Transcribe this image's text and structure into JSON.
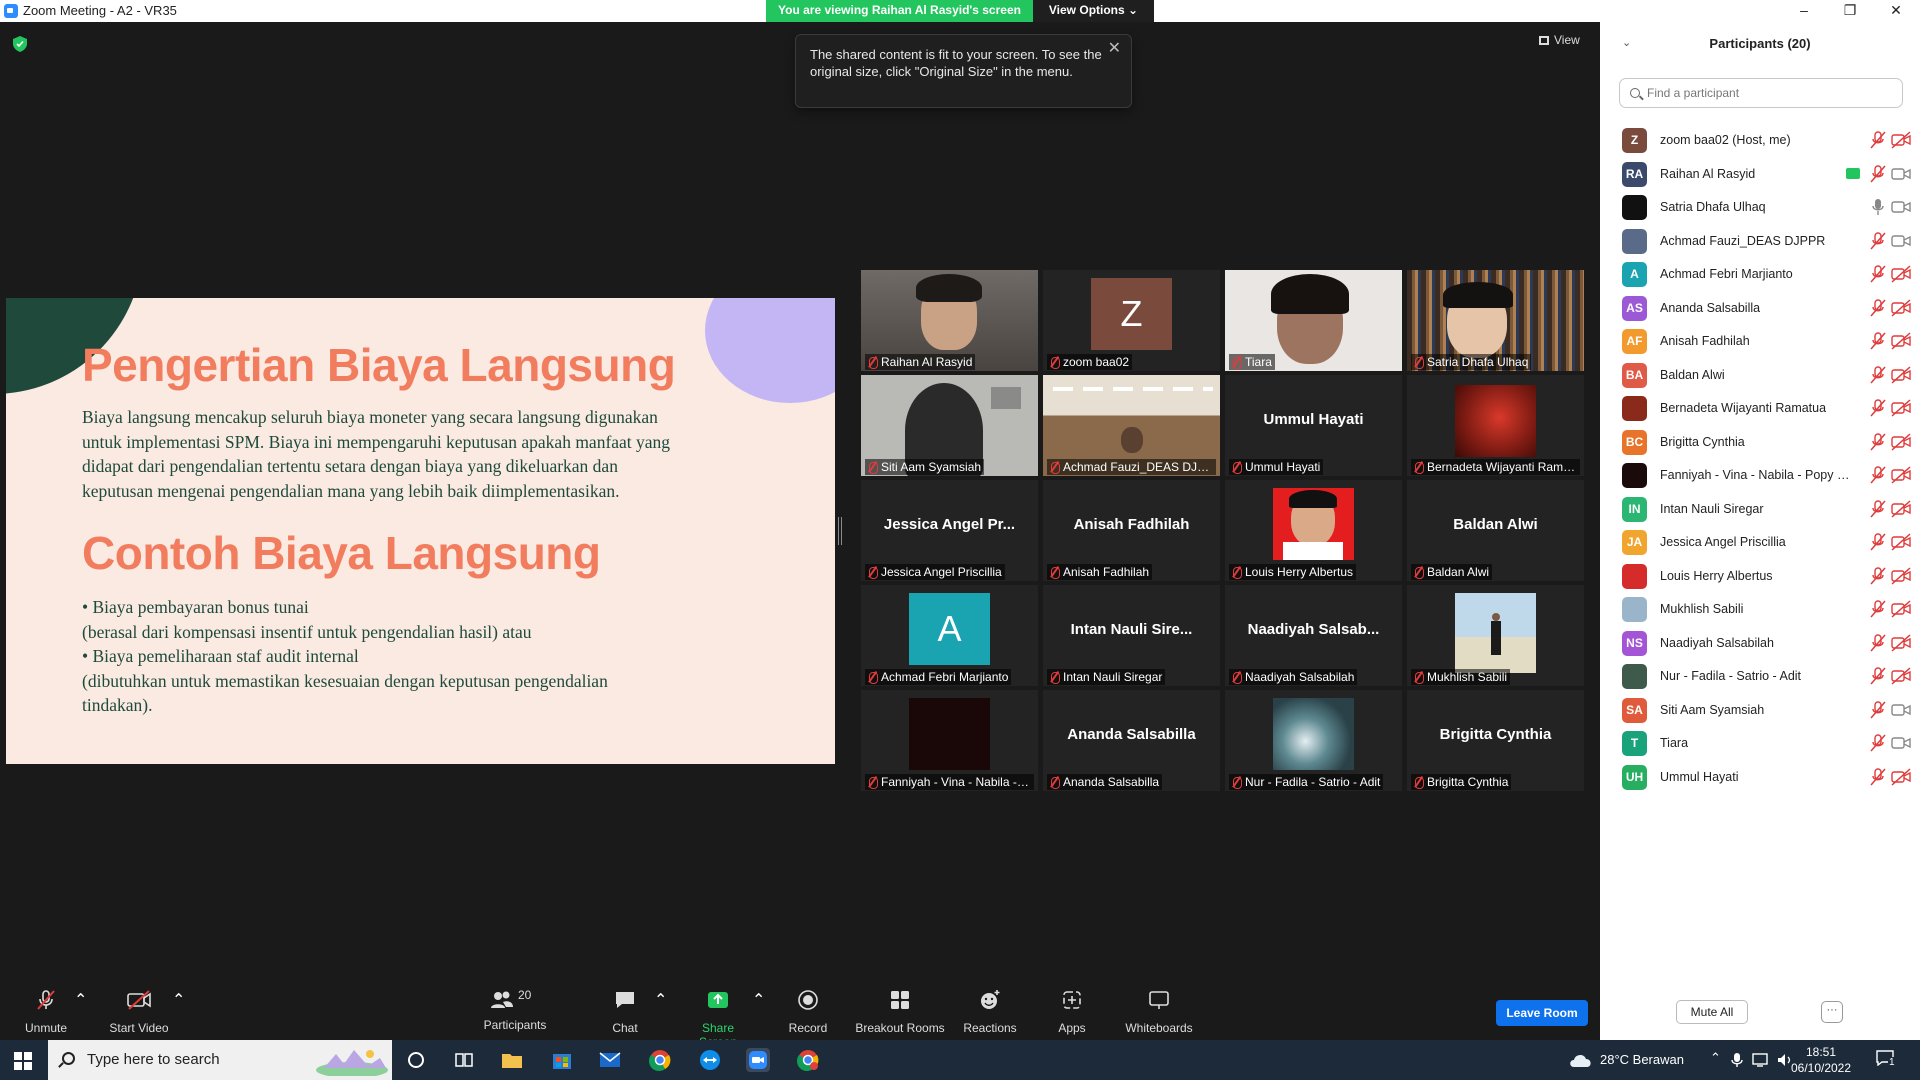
{
  "window": {
    "title": "Zoom Meeting - A2 - VR35",
    "viewing_banner": "You are viewing Raihan Al Rasyid's screen",
    "view_options": "View Options"
  },
  "tooltip": {
    "text": "The shared content is fit to your screen. To see the original size, click \"Original Size\" in the menu."
  },
  "view_button": "View",
  "slide": {
    "heading1": "Pengertian Biaya Langsung",
    "paragraph1": " Biaya langsung mencakup seluruh biaya moneter yang secara langsung digunakan untuk implementasi SPM. Biaya ini mempengaruhi keputusan apakah manfaat yang didapat dari pengendalian tertentu setara dengan biaya yang dikeluarkan dan keputusan mengenai pengendalian mana yang lebih baik diimplementasikan.",
    "heading2": "Contoh Biaya Langsung",
    "lines": [
      "• Biaya pembayaran bonus  tunai",
      "(berasal dari kompensasi insentif untuk pengendalian hasil) atau",
      "• Biaya pemeliharaan staf audit internal",
      "(dibutuhkan untuk memastikan kesesuaian dengan keputusan pengendalian",
      "tindakan)."
    ]
  },
  "tiles": [
    {
      "label": "Raihan Al Rasyid",
      "type": "video"
    },
    {
      "label": "zoom baa02",
      "type": "avatar",
      "letter": "Z"
    },
    {
      "label": "Tiara",
      "type": "video"
    },
    {
      "label": "Satria Dhafa Ulhaq",
      "type": "video",
      "active": true
    },
    {
      "label": "Siti Aam Syamsiah",
      "type": "video"
    },
    {
      "label": "Achmad Fauzi_DEAS DJPPR",
      "type": "video"
    },
    {
      "label": "Ummul Hayati",
      "type": "name",
      "bigname": "Ummul Hayati"
    },
    {
      "label": "Bernadeta Wijayanti Ramatua",
      "type": "photo"
    },
    {
      "label": "Jessica Angel Priscillia",
      "type": "name",
      "bigname": "Jessica Angel Pr..."
    },
    {
      "label": "Anisah Fadhilah",
      "type": "name",
      "bigname": "Anisah Fadhilah"
    },
    {
      "label": "Louis Herry Albertus",
      "type": "photo"
    },
    {
      "label": "Baldan Alwi",
      "type": "name",
      "bigname": "Baldan Alwi"
    },
    {
      "label": "Achmad Febri Marjianto",
      "type": "avatar",
      "letter": "A"
    },
    {
      "label": "Intan Nauli Siregar",
      "type": "name",
      "bigname": "Intan Nauli Sire..."
    },
    {
      "label": "Naadiyah Salsabilah",
      "type": "name",
      "bigname": "Naadiyah Salsab..."
    },
    {
      "label": "Mukhlish Sabili",
      "type": "photo"
    },
    {
      "label": "Fanniyah - Vina - Nabila - Popy - Adit",
      "type": "photo"
    },
    {
      "label": "Ananda Salsabilla",
      "type": "name",
      "bigname": "Ananda Salsabilla"
    },
    {
      "label": "Nur - Fadila - Satrio - Adit",
      "type": "photo"
    },
    {
      "label": "Brigitta Cynthia",
      "type": "name",
      "bigname": "Brigitta Cynthia"
    }
  ],
  "toolbar": {
    "unmute": "Unmute",
    "start_video": "Start Video",
    "participants": "Participants",
    "participants_count": "20",
    "chat": "Chat",
    "share_screen": "Share Screen",
    "record": "Record",
    "breakout_rooms": "Breakout Rooms",
    "reactions": "Reactions",
    "apps": "Apps",
    "whiteboards": "Whiteboards",
    "leave_room": "Leave Room"
  },
  "panel": {
    "title": "Participants (20)",
    "search_placeholder": "Find a participant",
    "mute_all": "Mute All",
    "more": "···",
    "participants": [
      {
        "initials": "Z",
        "name": "zoom baa02 (Host, me)",
        "color": "#7a4a3c",
        "cam": "off"
      },
      {
        "initials": "RA",
        "name": "Raihan Al Rasyid",
        "color": "#3b4a6b",
        "cam": "on",
        "sharing": true
      },
      {
        "initials": "",
        "name": "Satria Dhafa Ulhaq",
        "color": "#111111",
        "cam": "on",
        "mic": "on"
      },
      {
        "initials": "",
        "name": "Achmad Fauzi_DEAS DJPPR",
        "color": "#5a6b8a",
        "cam": "on"
      },
      {
        "initials": "A",
        "name": "Achmad Febri Marjianto",
        "color": "#1aa3b0",
        "cam": "off"
      },
      {
        "initials": "AS",
        "name": "Ananda Salsabilla",
        "color": "#9b59d6",
        "cam": "off"
      },
      {
        "initials": "AF",
        "name": "Anisah Fadhilah",
        "color": "#f29a2e",
        "cam": "off"
      },
      {
        "initials": "BA",
        "name": "Baldan Alwi",
        "color": "#e05a48",
        "cam": "off"
      },
      {
        "initials": "",
        "name": "Bernadeta Wijayanti Ramatua",
        "color": "#8a2a1a",
        "cam": "off"
      },
      {
        "initials": "BC",
        "name": "Brigitta Cynthia",
        "color": "#e8742c",
        "cam": "off"
      },
      {
        "initials": "",
        "name": "Fanniyah - Vina - Nabila - Popy - Adit",
        "color": "#1a0a0a",
        "cam": "off"
      },
      {
        "initials": "IN",
        "name": "Intan Nauli Siregar",
        "color": "#2bb673",
        "cam": "off"
      },
      {
        "initials": "JA",
        "name": "Jessica Angel Priscillia",
        "color": "#f0a52e",
        "cam": "off"
      },
      {
        "initials": "",
        "name": "Louis Herry Albertus",
        "color": "#d62b2b",
        "cam": "off"
      },
      {
        "initials": "",
        "name": "Mukhlish Sabili",
        "color": "#9ab5c9",
        "cam": "off"
      },
      {
        "initials": "NS",
        "name": "Naadiyah Salsabilah",
        "color": "#a455d6",
        "cam": "off"
      },
      {
        "initials": "",
        "name": "Nur - Fadila - Satrio - Adit",
        "color": "#3d5a4a",
        "cam": "off"
      },
      {
        "initials": "SA",
        "name": "Siti Aam Syamsiah",
        "color": "#e05a3c",
        "cam": "on"
      },
      {
        "initials": "T",
        "name": "Tiara",
        "color": "#1aa37a",
        "cam": "on"
      },
      {
        "initials": "UH",
        "name": "Ummul Hayati",
        "color": "#27ae60",
        "cam": "off"
      }
    ]
  },
  "taskbar": {
    "search_placeholder": "Type here to search",
    "weather": "28°C  Berawan",
    "time": "18:51",
    "date": "06/10/2022",
    "notifications": "1"
  }
}
